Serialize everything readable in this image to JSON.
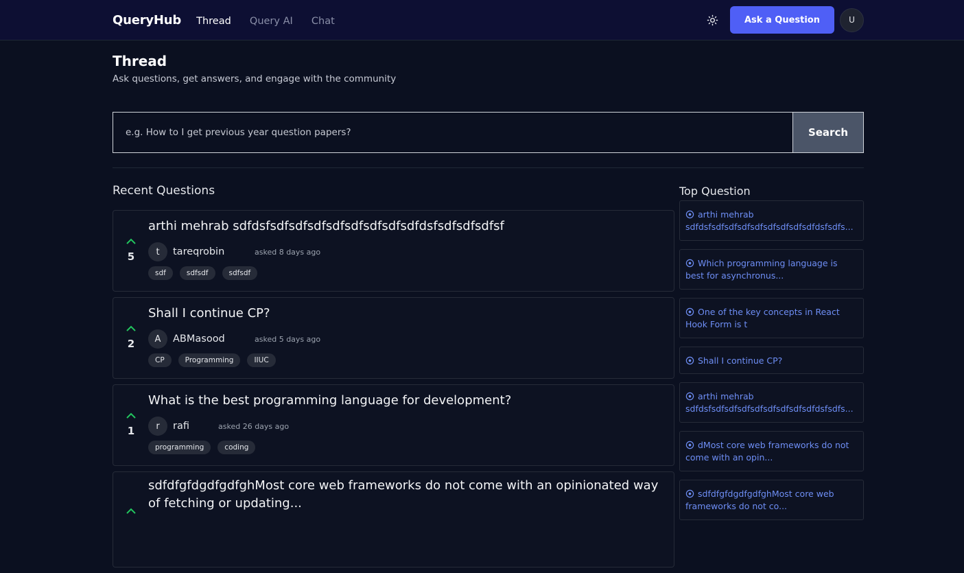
{
  "header": {
    "logo": "QueryHub",
    "nav": [
      "Thread",
      "Query AI",
      "Chat"
    ],
    "ask_button": "Ask a Question",
    "user_initial": "U"
  },
  "page": {
    "title": "Thread",
    "subtitle": "Ask questions, get answers, and engage with the community"
  },
  "search": {
    "placeholder": "e.g. How to I get previous year question papers?",
    "button": "Search"
  },
  "recent": {
    "title": "Recent Questions",
    "questions": [
      {
        "title": "arthi mehrab sdfdsfsdfsdfsdfsdfsdfsdfsdfsdfdsfsdfsdfsdfsf",
        "votes": "5",
        "avatar": "t",
        "author": "tareqrobin",
        "time": "asked 8 days ago",
        "tags": [
          "sdf",
          "sdfsdf",
          "sdfsdf"
        ]
      },
      {
        "title": "Shall I continue CP?",
        "votes": "2",
        "avatar": "A",
        "author": "ABMasood",
        "time": "asked 5 days ago",
        "tags": [
          "CP",
          "Programming",
          "IIUC"
        ]
      },
      {
        "title": "What is the best programming language for development?",
        "votes": "1",
        "avatar": "r",
        "author": "rafi",
        "time": "asked 26 days ago",
        "tags": [
          "programming",
          "coding"
        ]
      },
      {
        "title": "sdfdfgfdgdfgdfghMost core web frameworks do not come with an opinionated way of fetching or updating..."
      }
    ]
  },
  "top": {
    "title": "Top Question",
    "items": [
      {
        "l1": "arthi mehrab",
        "l2": "sdfdsfsdfsdfsdfsdfsdfsdfsdfsdfdsfsdfs..."
      },
      {
        "l1": "Which programming language is",
        "l2": "best for asynchronus..."
      },
      {
        "l1": "One of the key concepts in React",
        "l2": "Hook Form is t"
      },
      {
        "l1": "Shall I continue CP?",
        "l2": ""
      },
      {
        "l1": "arthi mehrab",
        "l2": "sdfdsfsdfsdfsdfsdfsdfsdfsdfsdfdsfsdfs..."
      },
      {
        "l1": "dMost core web frameworks do not",
        "l2": "come with an opin..."
      },
      {
        "l1": "sdfdfgfdgdfgdfghMost core web",
        "l2": "frameworks do not co..."
      }
    ]
  },
  "colors": {
    "accent": "#4f5ff6",
    "upvote": "#22c55e",
    "link": "#6e8ef5"
  }
}
